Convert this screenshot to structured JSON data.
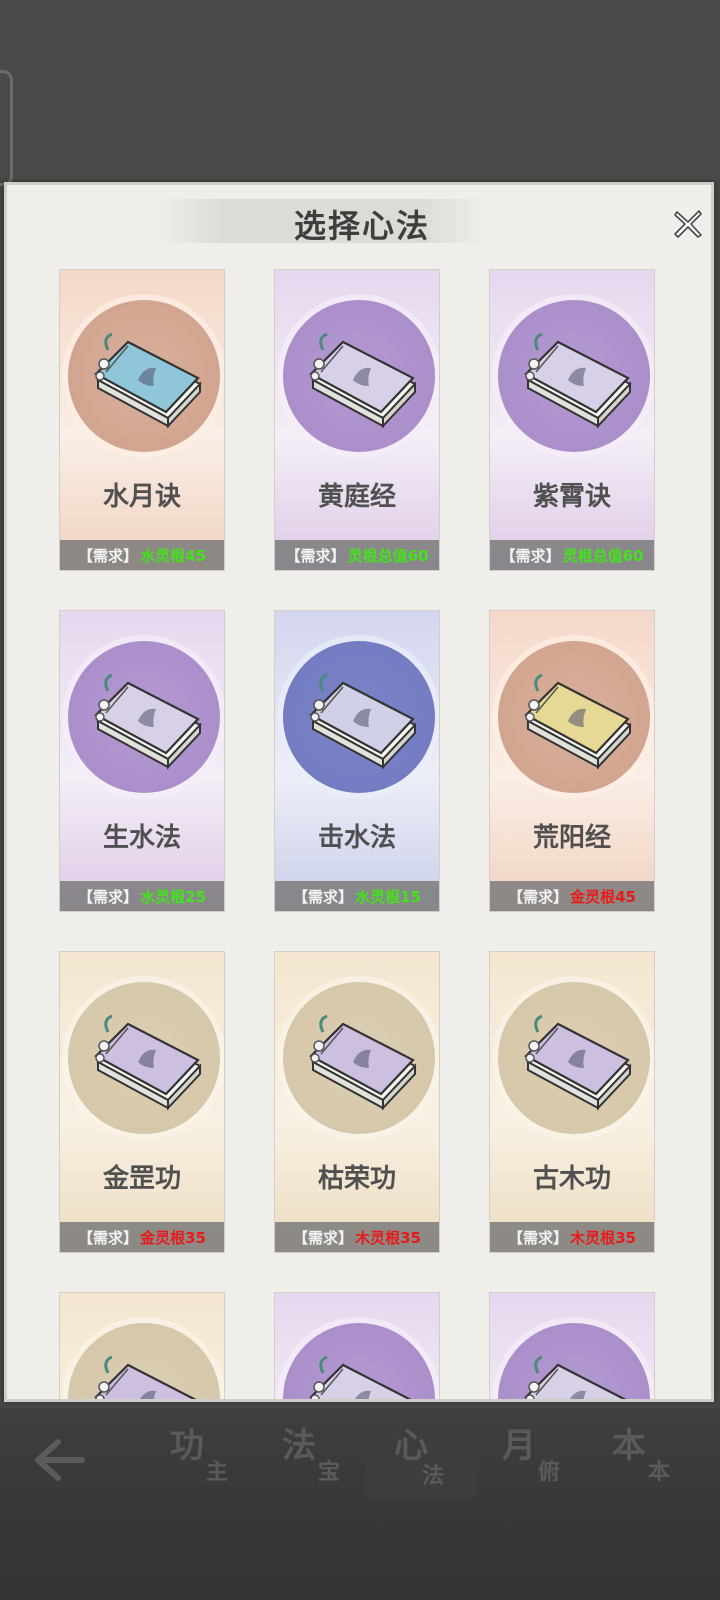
{
  "dialog": {
    "title": "选择心法",
    "close_label": "X"
  },
  "req_tag": "【需求】",
  "cards": [
    {
      "name": "水月诀",
      "requirement": "水灵根45",
      "theme": "peach",
      "book_color": "#8fc7d9",
      "req_color": "#44e21c"
    },
    {
      "name": "黄庭经",
      "requirement": "灵根总值60",
      "theme": "lilac",
      "book_color": "#d8d0e6",
      "req_color": "#44e21c"
    },
    {
      "name": "紫霄诀",
      "requirement": "灵根总值60",
      "theme": "lilac",
      "book_color": "#d8d0e6",
      "req_color": "#44e21c"
    },
    {
      "name": "生水法",
      "requirement": "水灵根25",
      "theme": "lilac",
      "book_color": "#d8d0e6",
      "req_color": "#44e21c"
    },
    {
      "name": "击水法",
      "requirement": "水灵根15",
      "theme": "blue",
      "book_color": "#d0d0e6",
      "req_color": "#44e21c"
    },
    {
      "name": "荒阳经",
      "requirement": "金灵根45",
      "theme": "peach",
      "book_color": "#e6d995",
      "req_color": "#e81b1b"
    },
    {
      "name": "金罡功",
      "requirement": "金灵根35",
      "theme": "gold",
      "book_color": "#cdbfdf",
      "req_color": "#e81b1b"
    },
    {
      "name": "枯荣功",
      "requirement": "木灵根35",
      "theme": "gold",
      "book_color": "#cdbfdf",
      "req_color": "#e81b1b"
    },
    {
      "name": "古木功",
      "requirement": "木灵根35",
      "theme": "gold",
      "book_color": "#cdbfdf",
      "req_color": "#e81b1b"
    },
    {
      "name": "",
      "requirement": "",
      "theme": "gold",
      "book_color": "#cdbfdf",
      "req_color": "#e81b1b"
    },
    {
      "name": "",
      "requirement": "",
      "theme": "lilac",
      "book_color": "#d8d0e6",
      "req_color": "#44e21c"
    },
    {
      "name": "",
      "requirement": "",
      "theme": "lilac",
      "book_color": "#d8d0e6",
      "req_color": "#44e21c"
    }
  ],
  "bottom_nav": {
    "back_icon": "arrow-left-icon",
    "tabs": [
      {
        "big": "功",
        "small": "主",
        "active": false
      },
      {
        "big": "法",
        "small": "宝",
        "active": false
      },
      {
        "big": "心",
        "small": "法",
        "active": true
      },
      {
        "big": "月",
        "small": "俯",
        "active": false
      },
      {
        "big": "本",
        "small": "本",
        "active": false
      }
    ]
  }
}
